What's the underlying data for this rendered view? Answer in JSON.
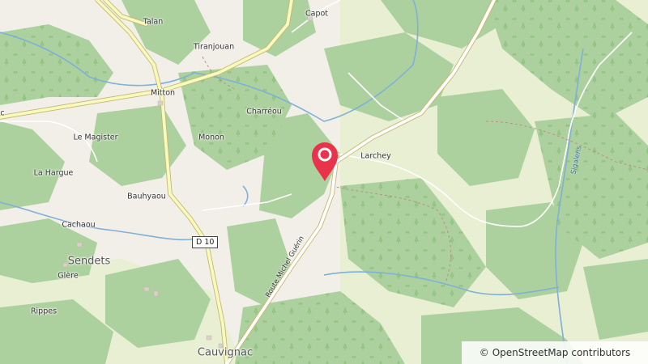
{
  "map": {
    "labels": {
      "talan": "Talan",
      "capot": "Capot",
      "tiranjouan": "Tiranjouan",
      "mitton": "Mitton",
      "charreou": "Charréou",
      "le_magister": "Le Magister",
      "monon": "Monon",
      "larchey": "Larchey",
      "la_hargue": "La Hargue",
      "bauhyaou": "Bauhyaou",
      "cachaou": "Cachaou",
      "sendets": "Sendets",
      "glere": "Glère",
      "rippes": "Rippes",
      "cauvignac": "Cauvignac",
      "edge_c": "c"
    },
    "road_shield": "D 10",
    "road_name": "Route Michel Guérin",
    "stream_name": "Sigalens",
    "marker_icon": "map-pin-icon",
    "colors": {
      "background": "#f2efe9",
      "forest": "#add19e",
      "meadow": "#e8efd2",
      "road_major": "#f7fabf",
      "road_casing": "#c6b46b",
      "water": "#7fb0d8",
      "marker": "#e8334a"
    }
  },
  "attribution": {
    "symbol": "©",
    "text": "OpenStreetMap contributors"
  }
}
